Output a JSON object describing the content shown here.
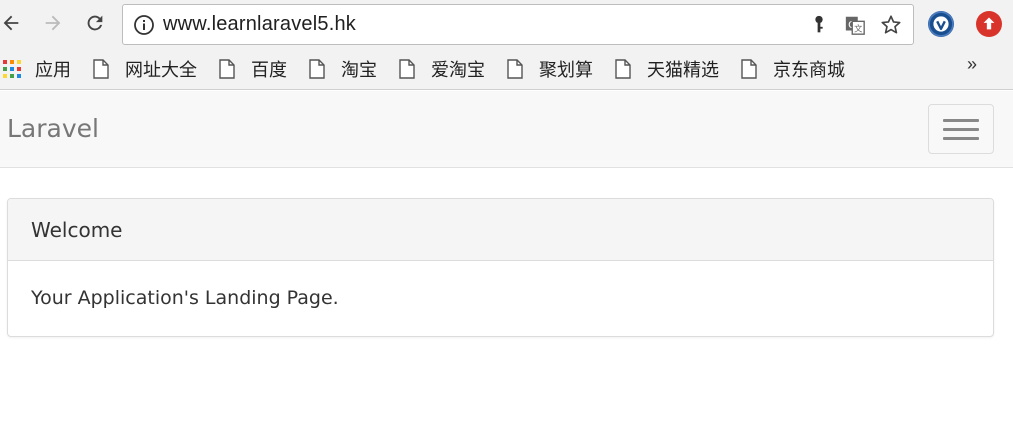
{
  "browser": {
    "url": "www.learnlaravel5.hk",
    "nav_icons": [
      "back-icon",
      "forward-icon",
      "reload-icon"
    ],
    "omnibox_icons": [
      "info-icon",
      "key-icon",
      "translate-icon",
      "star-icon"
    ],
    "extensions": [
      "vimeo-extension-icon",
      "upload-extension-icon"
    ]
  },
  "bookmarks": {
    "apps_label": "应用",
    "items": [
      {
        "label": "网址大全"
      },
      {
        "label": "百度"
      },
      {
        "label": "淘宝"
      },
      {
        "label": "爱淘宝"
      },
      {
        "label": "聚划算"
      },
      {
        "label": "天猫精选"
      },
      {
        "label": "京东商城"
      }
    ],
    "more_label": "»"
  },
  "page": {
    "brand": "Laravel",
    "panel": {
      "heading": "Welcome",
      "body": "Your Application's Landing Page."
    }
  },
  "colors": {
    "navbar_bg": "#f8f8f8",
    "brand_text": "#777777",
    "panel_heading_bg": "#f5f5f5",
    "vimeo_ext": "#1a4f8f",
    "upload_ext": "#d9342b"
  }
}
